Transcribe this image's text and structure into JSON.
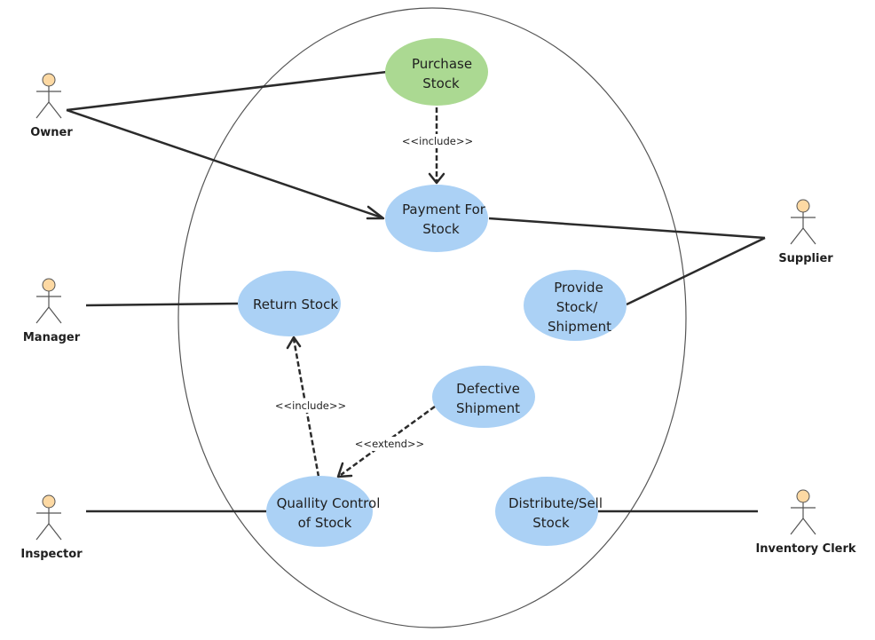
{
  "diagram": {
    "type": "UML use case diagram",
    "colors": {
      "use_case_blue": "#abd1f5",
      "use_case_green": "#abd992",
      "actor_head": "#fdd9a3",
      "line": "#2b2b2b",
      "boundary": "#555555"
    },
    "actors": [
      {
        "id": "owner",
        "label": "Owner"
      },
      {
        "id": "manager",
        "label": "Manager"
      },
      {
        "id": "inspector",
        "label": "Inspector"
      },
      {
        "id": "supplier",
        "label": "Supplier"
      },
      {
        "id": "inventory_clerk",
        "label": "Inventory Clerk"
      }
    ],
    "use_cases": [
      {
        "id": "purchase_stock",
        "lines": [
          "Purchase",
          "Stock"
        ],
        "color": "green"
      },
      {
        "id": "payment_for_stock",
        "lines": [
          "Payment For",
          "Stock"
        ],
        "color": "blue"
      },
      {
        "id": "return_stock",
        "lines": [
          "Return Stock"
        ],
        "color": "blue"
      },
      {
        "id": "provide_stock",
        "lines": [
          "Provide",
          "Stock/",
          "Shipment"
        ],
        "color": "blue"
      },
      {
        "id": "defective_shipment",
        "lines": [
          "Defective",
          "Shipment"
        ],
        "color": "blue"
      },
      {
        "id": "quality_control",
        "lines": [
          "Quallity Control",
          "of Stock"
        ],
        "color": "blue"
      },
      {
        "id": "distribute_sell",
        "lines": [
          "Distribute/Sell",
          "Stock"
        ],
        "color": "blue"
      }
    ],
    "relationships": [
      {
        "from": "owner",
        "to": "purchase_stock",
        "kind": "association"
      },
      {
        "from": "owner",
        "to": "payment_for_stock",
        "kind": "directed-association"
      },
      {
        "from": "purchase_stock",
        "to": "payment_for_stock",
        "kind": "include",
        "label": "<<include>>"
      },
      {
        "from": "payment_for_stock",
        "to": "supplier",
        "kind": "association"
      },
      {
        "from": "provide_stock",
        "to": "supplier",
        "kind": "association"
      },
      {
        "from": "manager",
        "to": "return_stock",
        "kind": "association"
      },
      {
        "from": "quality_control",
        "to": "return_stock",
        "kind": "include",
        "label": "<<include>>"
      },
      {
        "from": "defective_shipment",
        "to": "quality_control",
        "kind": "extend",
        "label": "<<extend>>"
      },
      {
        "from": "inspector",
        "to": "quality_control",
        "kind": "association"
      },
      {
        "from": "distribute_sell",
        "to": "inventory_clerk",
        "kind": "association"
      }
    ]
  }
}
